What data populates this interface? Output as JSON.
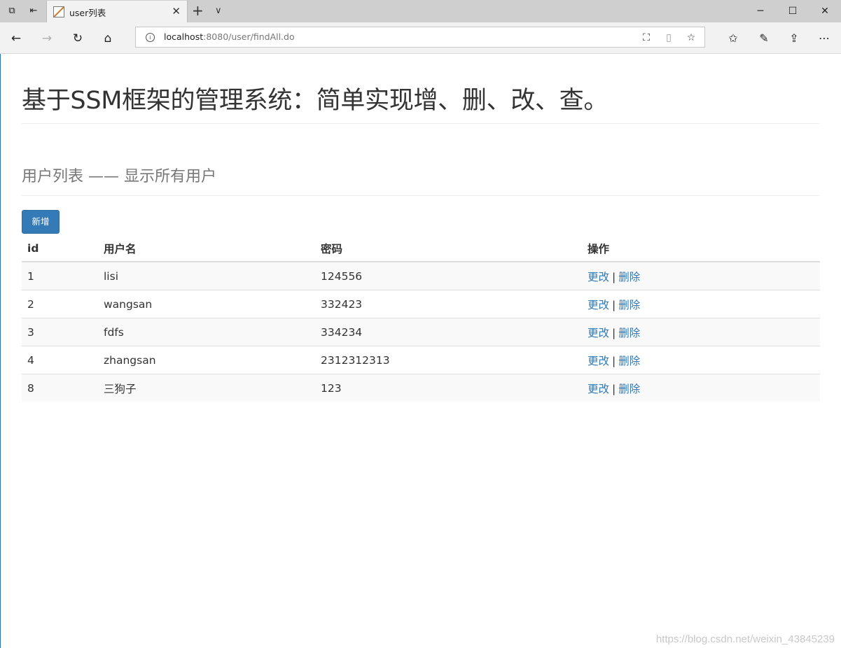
{
  "browser": {
    "tab_title": "user列表",
    "url_host": "localhost",
    "url_rest": ":8080/user/findAll.do"
  },
  "page": {
    "title": "基于SSM框架的管理系统：简单实现增、删、改、查。",
    "subtitle": "用户列表 —— 显示所有用户",
    "add_button": "新增"
  },
  "table": {
    "headers": [
      "id",
      "用户名",
      "密码",
      "操作"
    ],
    "rows": [
      {
        "id": "1",
        "name": "lisi",
        "password": "124556"
      },
      {
        "id": "2",
        "name": "wangsan",
        "password": "332423"
      },
      {
        "id": "3",
        "name": "fdfs",
        "password": "334234"
      },
      {
        "id": "4",
        "name": "zhangsan",
        "password": "2312312313"
      },
      {
        "id": "8",
        "name": "三狗子",
        "password": "123"
      }
    ],
    "edit_label": "更改",
    "separator": "|",
    "delete_label": "删除"
  },
  "watermark": "https://blog.csdn.net/weixin_43845239"
}
